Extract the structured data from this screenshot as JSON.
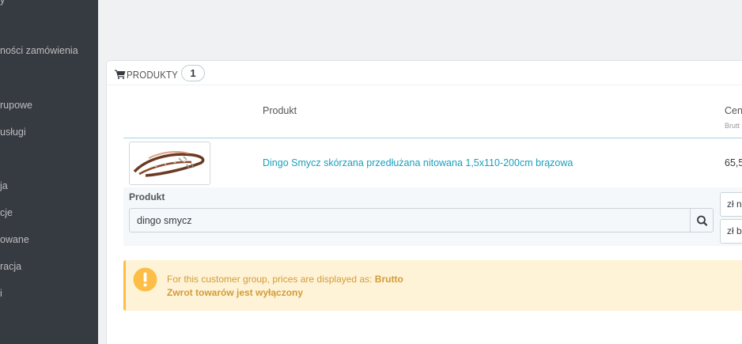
{
  "sidebar": {
    "items": [
      {
        "label": "y"
      },
      {
        "label": "ności zamówienia"
      },
      {
        "label": "rupowe"
      },
      {
        "label": "usługi"
      },
      {
        "label": "ja"
      },
      {
        "label": "cje"
      },
      {
        "label": "owane"
      },
      {
        "label": "racja"
      },
      {
        "label": "i"
      }
    ]
  },
  "products_panel": {
    "title": "PRODUKTY",
    "count": "1",
    "columns": {
      "product": "Produkt",
      "price": "Cen",
      "price_sub": "Brutt"
    },
    "rows": [
      {
        "image_icon": "dog-leash-thumbnail",
        "name": "Dingo Smycz skórzana przedłużana nitowana 1,5x110-200cm brązowa",
        "price": "65,5"
      }
    ],
    "search": {
      "label": "Produkt",
      "value": "dingo smycz",
      "button_icon": "search-icon",
      "side_button_1": "zł n",
      "side_button_2": "zł b"
    },
    "alert": {
      "icon": "exclamation-icon",
      "line1_prefix": "For this customer group, prices are displayed as: ",
      "line1_value": "Brutto",
      "line2": "Zwrot towarów jest wyłączony"
    }
  },
  "colors": {
    "sidebar_bg": "#363a41",
    "link": "#1a9fbd",
    "alert_bg": "#fff3d7",
    "alert_accent": "#fcbe47",
    "alert_text": "#d29b36"
  }
}
